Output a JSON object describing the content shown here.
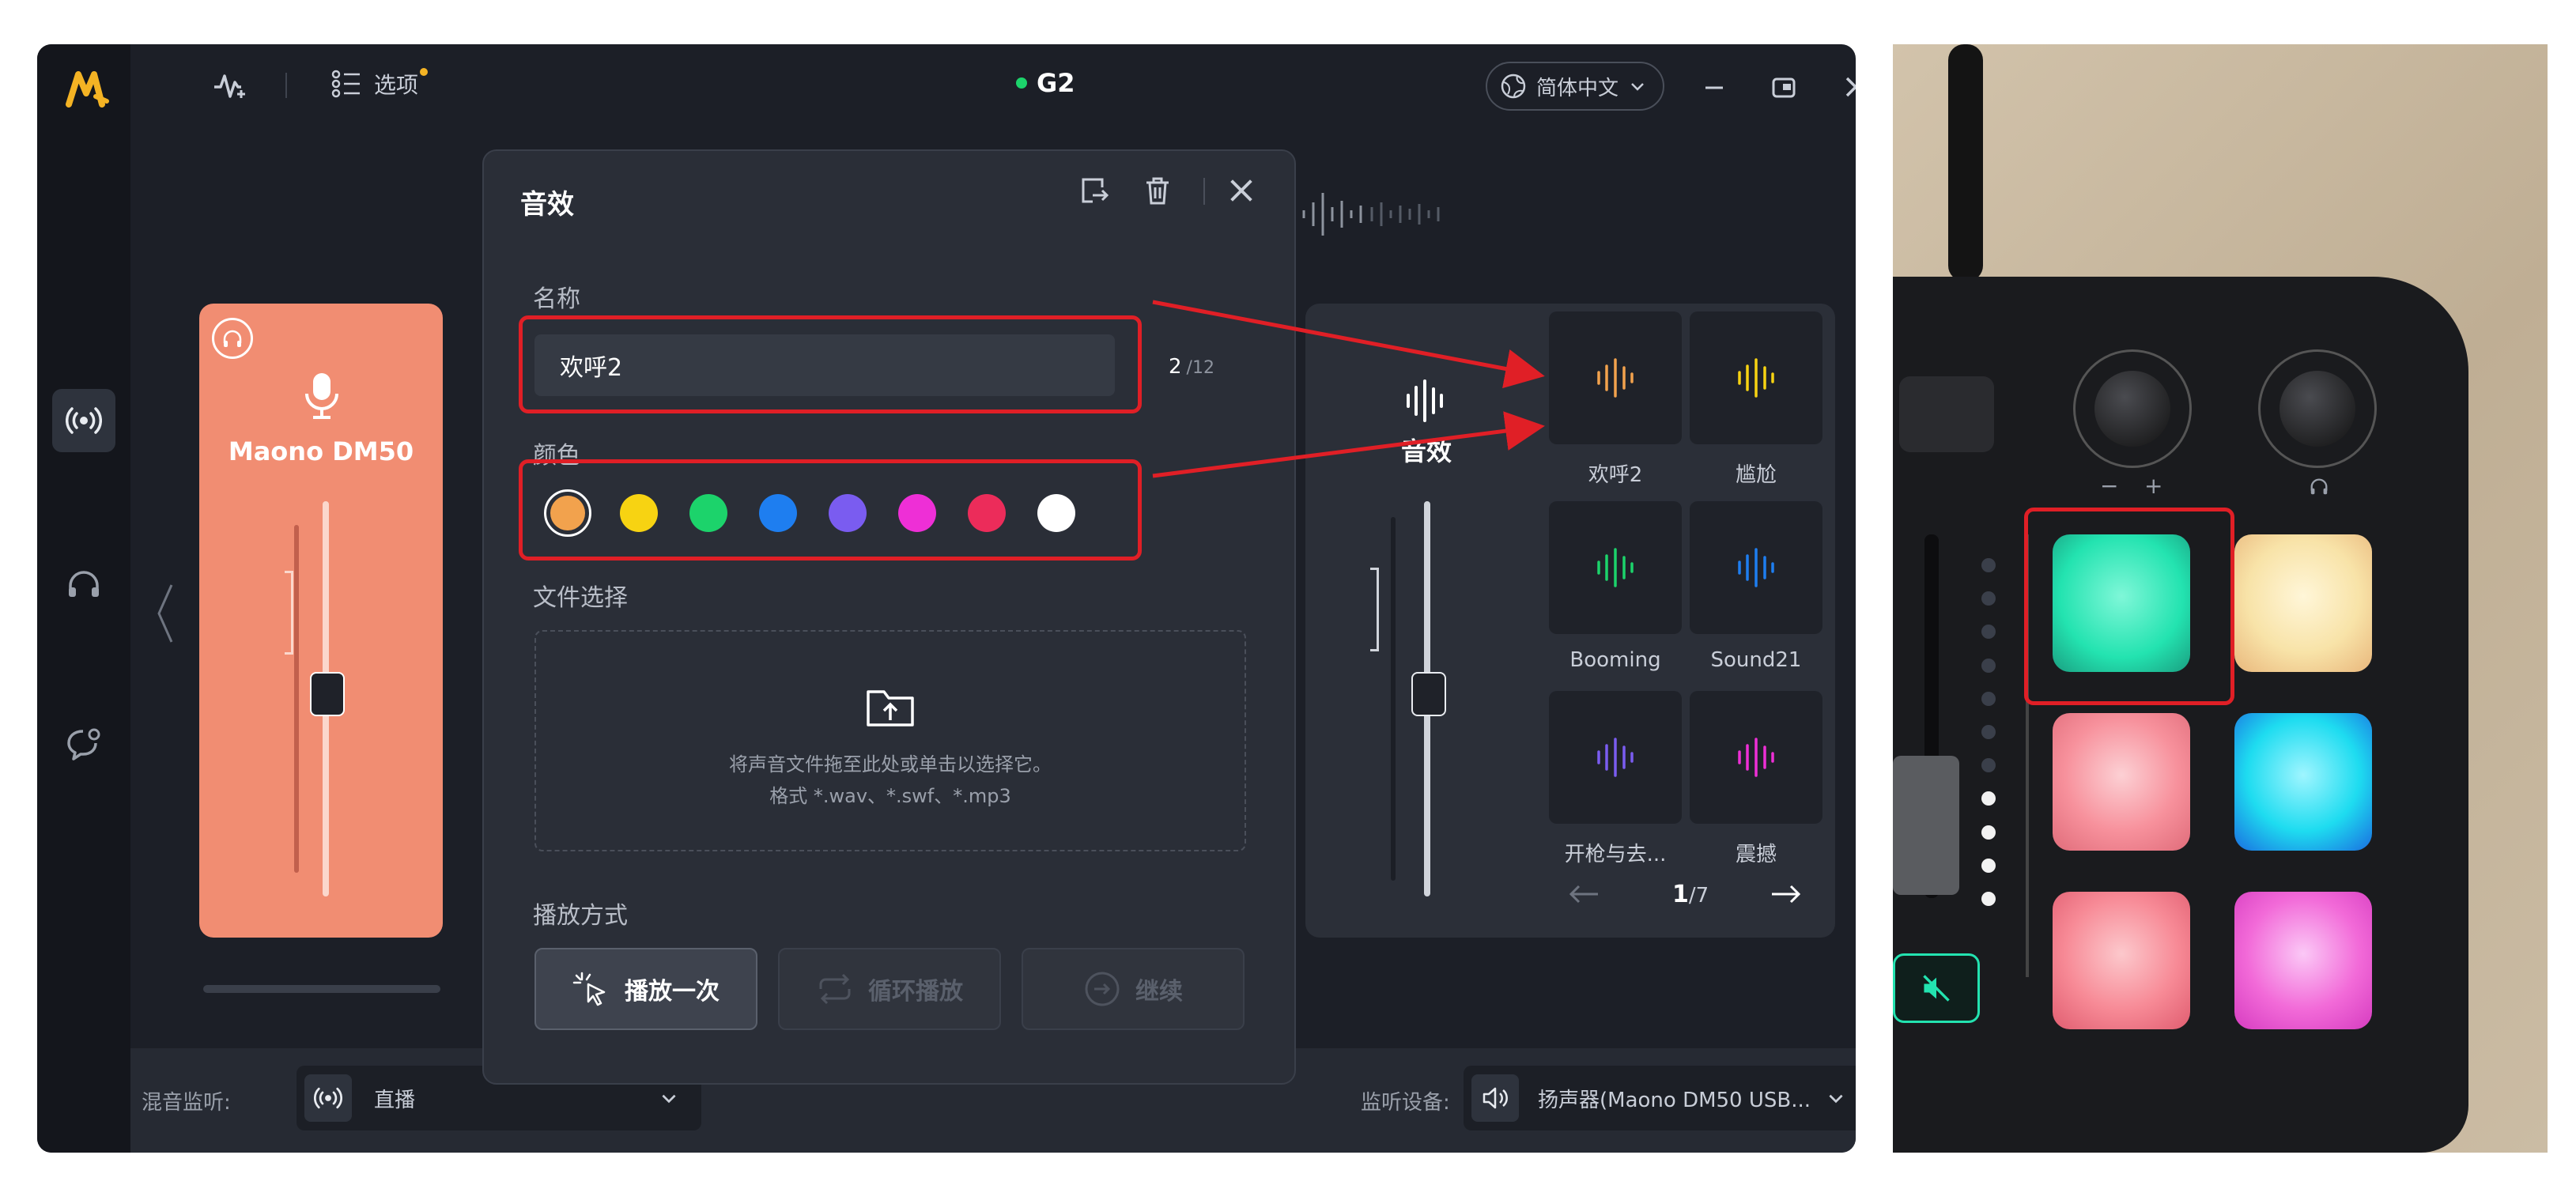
{
  "app": {
    "logo": "M",
    "tab_options": "选项",
    "device_name": "G2",
    "language": "简体中文"
  },
  "sidebar": {
    "icons": [
      "broadcast-icon",
      "headphones-icon",
      "chat-heart-icon"
    ]
  },
  "left_card": {
    "device": "Maono DM50"
  },
  "dialog": {
    "title": "音效",
    "name_label": "名称",
    "name_value": "欢呼2",
    "name_count": "2",
    "name_max": "/12",
    "color_label": "颜色",
    "colors": [
      "#f2a24d",
      "#f7d312",
      "#1cd36b",
      "#1e7ef0",
      "#7a5cf0",
      "#ee2fd6",
      "#ec2c5a",
      "#ffffff"
    ],
    "selected_color": "#f2a24d",
    "file_label": "文件选择",
    "drop_hint": "将声音文件拖至此处或单击以选择它。",
    "drop_formats": "格式 *.wav、*.swf、*.mp3",
    "play_label": "播放方式",
    "play_once": "播放一次",
    "play_loop": "循环播放",
    "play_continue": "继续"
  },
  "right_panel": {
    "title": "音效",
    "pads": [
      {
        "label": "欢呼2",
        "color": "#f2a24d"
      },
      {
        "label": "尴尬",
        "color": "#f7d312"
      },
      {
        "label": "Booming",
        "color": "#1cd36b"
      },
      {
        "label": "Sound21",
        "color": "#1e7ef0"
      },
      {
        "label": "开枪与去...",
        "color": "#7a5cf0"
      },
      {
        "label": "震撼",
        "color": "#ee2fd6"
      }
    ],
    "page_current": "1",
    "page_total": "/7"
  },
  "bottom": {
    "mix_label": "混音监听:",
    "mix_value": "直播",
    "monitor_label": "监听设备:",
    "monitor_value": "扬声器(Maono DM50 USB..."
  },
  "photo": {
    "knob_left_minus": "−",
    "knob_left_plus": "+",
    "pad_colors": [
      "#23e3b0",
      "#f8e3a8",
      "#f7919c",
      "#1edcf0",
      "#f78a96",
      "#f26ad8"
    ]
  }
}
